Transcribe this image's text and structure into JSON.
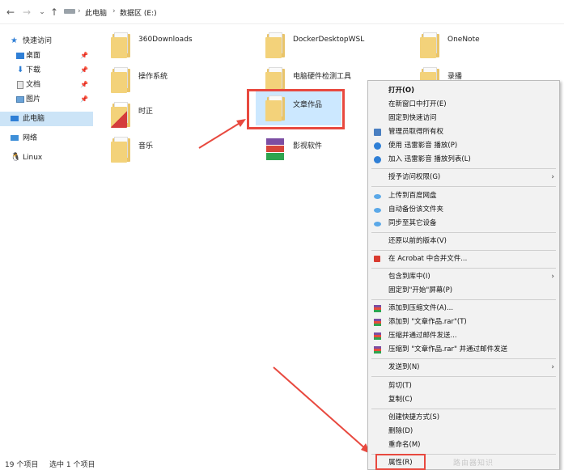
{
  "address_bar": {
    "back": "←",
    "forward": "→",
    "recent": "⌄",
    "up": "↑",
    "sep": "›",
    "crumbs": [
      "此电脑",
      "数据区 (E:)"
    ]
  },
  "sidebar": {
    "items": [
      {
        "label": "快速访问"
      },
      {
        "label": "桌面",
        "pin": "📌"
      },
      {
        "label": "下载",
        "pin": "📌"
      },
      {
        "label": "文档",
        "pin": "📌"
      },
      {
        "label": "图片",
        "pin": "📌"
      },
      {
        "label": "此电脑"
      },
      {
        "label": "网络"
      },
      {
        "label": "Linux"
      }
    ]
  },
  "files": [
    {
      "name": "360Downloads",
      "icon": "folder-icon"
    },
    {
      "name": "DockerDesktopWSL",
      "icon": "folder-icon"
    },
    {
      "name": "OneNote",
      "icon": "folder-icon"
    },
    {
      "name": "操作系统",
      "icon": "folder-icon"
    },
    {
      "name": "电脑硬件检测工具",
      "icon": "folder-icon"
    },
    {
      "name": "录播",
      "icon": "folder-icon"
    },
    {
      "name": "时正",
      "icon": "folder-icon"
    },
    {
      "name": "文章作品",
      "icon": "folder-icon",
      "selected": true
    },
    {
      "name": "音乐",
      "icon": "folder-icon"
    },
    {
      "name": "影视软件",
      "icon": "winrar-archive-icon"
    }
  ],
  "status": {
    "count": "19 个项目",
    "selection": "选中 1 个项目"
  },
  "context_menu": {
    "items": [
      {
        "label": "打开(O)",
        "bold": true
      },
      {
        "label": "在新窗口中打开(E)"
      },
      {
        "label": "固定到快速访问"
      },
      {
        "label": "管理员取得所有权",
        "icon": "admin-icon"
      },
      {
        "label": "使用 迅雷影音 播放(P)",
        "icon": "thunder-player-icon"
      },
      {
        "label": "加入 迅雷影音 播放列表(L)",
        "icon": "thunder-player-icon"
      },
      {
        "label": "授予访问权限(G)",
        "submenu": true
      },
      {
        "label": "上传到百度网盘",
        "icon": "baidu-cloud-icon"
      },
      {
        "label": "自动备份该文件夹",
        "icon": "baidu-cloud-icon"
      },
      {
        "label": "同步至其它设备",
        "icon": "baidu-cloud-icon"
      },
      {
        "label": "还原以前的版本(V)"
      },
      {
        "label": "在 Acrobat 中合并文件...",
        "icon": "acrobat-icon"
      },
      {
        "label": "包含到库中(I)",
        "submenu": true
      },
      {
        "label": "固定到\"开始\"屏幕(P)"
      },
      {
        "label": "添加到压缩文件(A)...",
        "icon": "winrar-icon"
      },
      {
        "label": "添加到 \"文章作品.rar\"(T)",
        "icon": "winrar-icon"
      },
      {
        "label": "压缩并通过邮件发送...",
        "icon": "winrar-icon"
      },
      {
        "label": "压缩到 \"文章作品.rar\" 并通过邮件发送",
        "icon": "winrar-icon"
      },
      {
        "label": "发送到(N)",
        "submenu": true
      },
      {
        "label": "剪切(T)"
      },
      {
        "label": "复制(C)"
      },
      {
        "label": "创建快捷方式(S)"
      },
      {
        "label": "删除(D)"
      },
      {
        "label": "重命名(M)"
      },
      {
        "label": "属性(R)"
      }
    ],
    "submenu_arrow": "›"
  },
  "colors": {
    "annotation": "#e8493f",
    "selection": "#cce8ff",
    "folder": "#f3d27a"
  },
  "watermark": "路由器知识"
}
